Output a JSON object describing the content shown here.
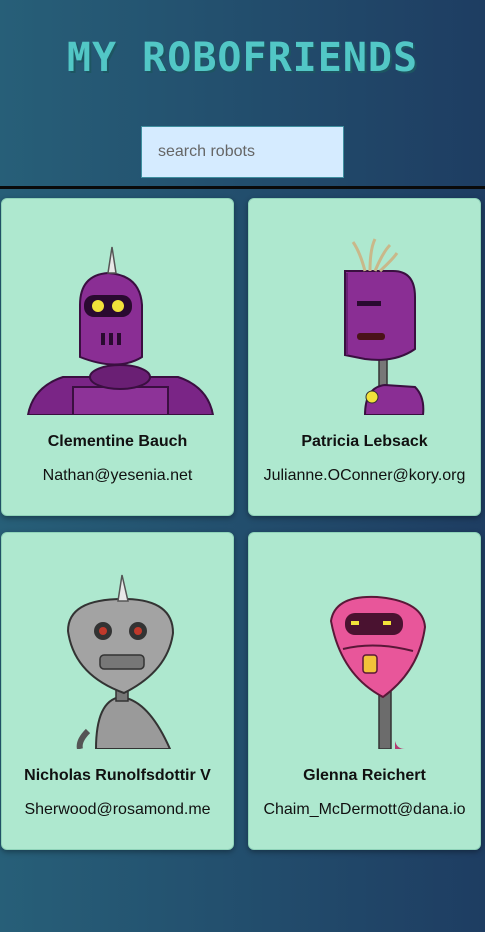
{
  "app": {
    "title": "My Robofriends"
  },
  "search": {
    "placeholder": "search robots"
  },
  "robots": [
    {
      "name": "Clementine Bauch",
      "email": "Nathan@yesenia.net",
      "color": "#8a2e94"
    },
    {
      "name": "Patricia Lebsack",
      "email": "Julianne.OConner@kory.org",
      "color": "#8a2e94"
    },
    {
      "name": "Nicholas Runolfsdottir V",
      "email": "Sherwood@rosamond.me",
      "color": "#9a9a9a"
    },
    {
      "name": "Glenna Reichert",
      "email": "Chaim_McDermott@dana.io",
      "color": "#e8569a"
    }
  ]
}
